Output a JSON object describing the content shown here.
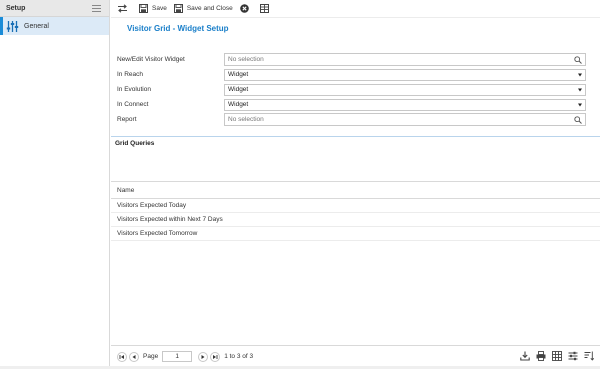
{
  "sidebar": {
    "title": "Setup",
    "items": [
      {
        "label": "General",
        "icon": "sliders-icon"
      }
    ]
  },
  "toolbar": {
    "save_label": "Save",
    "save_close_label": "Save and Close"
  },
  "page": {
    "title": "Visitor Grid - Widget Setup"
  },
  "form": {
    "fields": [
      {
        "label": "New/Edit Visitor Widget",
        "type": "lookup",
        "value": "",
        "placeholder": "No selection"
      },
      {
        "label": "In Reach",
        "type": "select",
        "value": "Widget"
      },
      {
        "label": "In Evolution",
        "type": "select",
        "value": "Widget"
      },
      {
        "label": "In Connect",
        "type": "select",
        "value": "Widget"
      },
      {
        "label": "Report",
        "type": "lookup",
        "value": "",
        "placeholder": "No selection"
      }
    ]
  },
  "grid": {
    "title": "Grid Queries",
    "columns": [
      "Name"
    ],
    "rows": [
      [
        "Visitors Expected Today"
      ],
      [
        "Visitors Expected within Next 7 Days"
      ],
      [
        "Visitors Expected Tomorrow"
      ]
    ]
  },
  "pager": {
    "page_label": "Page",
    "current_page": "1",
    "info": "1 to 3 of 3"
  },
  "colors": {
    "accent": "#1a7fc9",
    "selected_bg": "#dceaf7"
  }
}
